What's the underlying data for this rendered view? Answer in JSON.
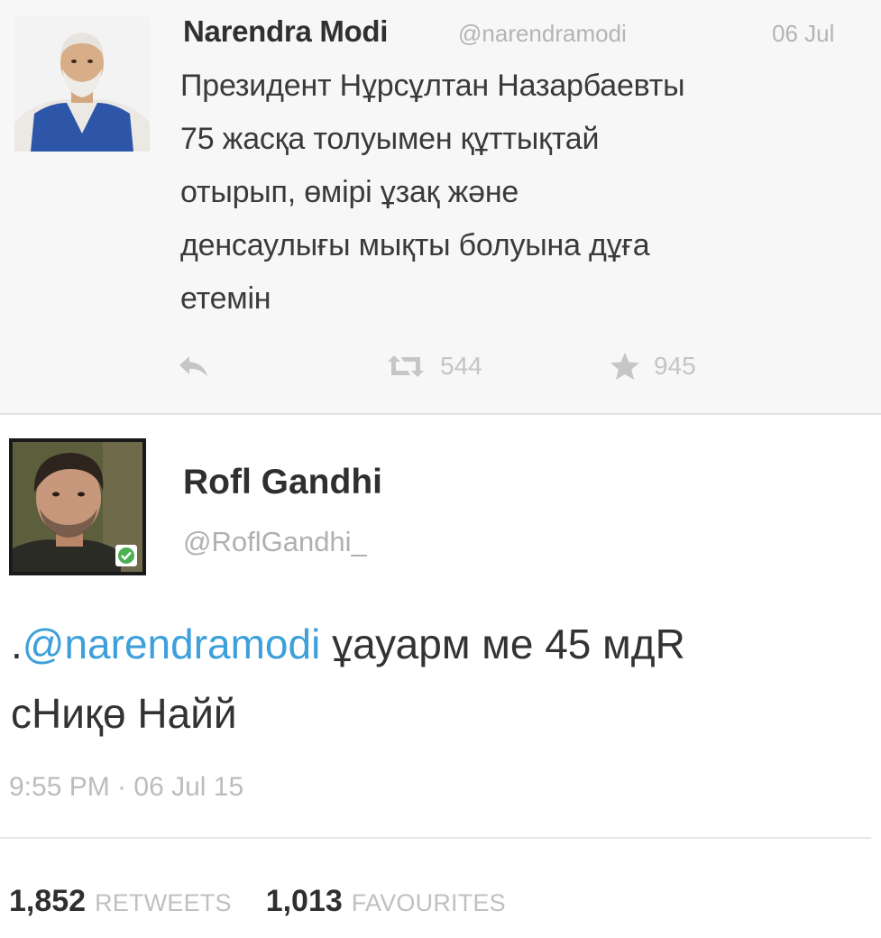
{
  "tweets": [
    {
      "author_name": "Narendra Modi",
      "handle": "@narendramodi",
      "date": "06 Jul",
      "body_lines": [
        "Президент Нұрсұлтан Назарбаевты",
        "75 жасқа толуымен құттықтай",
        "отырып, өмірі ұзақ және",
        "денсаулығы мықты болуына дұға",
        "етемін"
      ],
      "actions": {
        "reply_icon": "reply-icon",
        "retweet_icon": "retweet-icon",
        "retweet_count": "544",
        "favorite_icon": "star-icon",
        "favorite_count": "945"
      }
    },
    {
      "author_name": "Rofl Gandhi",
      "handle": "@RoflGandhi_",
      "body": {
        "prefix": ".",
        "mention": "@narendramodi",
        "line1_rest": " ұауарм ме 45 мдR",
        "line2": "сНиқө Найй"
      },
      "timestamp": "9:55 PM · 06 Jul 15",
      "stats": {
        "retweets_count": "1,852",
        "retweets_label": "RETWEETS",
        "favourites_count": "1,013",
        "favourites_label": "FAVOURITES"
      }
    }
  ],
  "colors": {
    "mention": "#3ea0da",
    "muted": "#b4b4b4",
    "verified": "#4caf50"
  }
}
